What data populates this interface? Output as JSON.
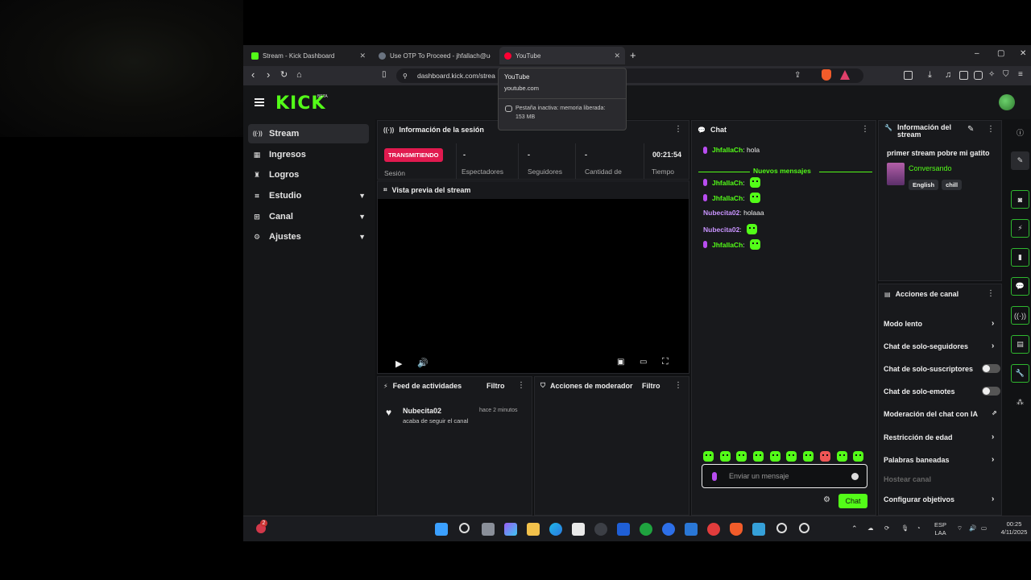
{
  "browser": {
    "tabs": [
      {
        "title": "Stream - Kick Dashboard",
        "color": "#53fc18"
      },
      {
        "title": "Use OTP To Proceed - jhfallach@ucn",
        "color": "#6a7380"
      },
      {
        "title": "YouTube",
        "color": "#ff0033"
      }
    ],
    "new_tab": "+",
    "window_controls": [
      "–",
      "▢",
      "✕"
    ],
    "url": "dashboard.kick.com/strea",
    "tooltip": {
      "title": "YouTube",
      "domain": "youtube.com",
      "memory_line1": "Pestaña inactiva: memoria liberada:",
      "memory_line2": "153 MB"
    }
  },
  "header": {
    "logo": "KICK",
    "badge": "BETA"
  },
  "sidebar": {
    "items": [
      {
        "label": "Stream",
        "icon": "stream-icon",
        "glyph": "((·))",
        "expandable": false
      },
      {
        "label": "Ingresos",
        "icon": "income-icon",
        "glyph": "▦",
        "expandable": false
      },
      {
        "label": "Logros",
        "icon": "trophy-icon",
        "glyph": "🏆",
        "expandable": false
      },
      {
        "label": "Estudio",
        "icon": "studio-icon",
        "glyph": "⌗",
        "expandable": true
      },
      {
        "label": "Canal",
        "icon": "channel-icon",
        "glyph": "⊞",
        "expandable": true
      },
      {
        "label": "Ajustes",
        "icon": "settings-icon",
        "glyph": "⚙",
        "expandable": true
      }
    ]
  },
  "session": {
    "title": "Información de la sesión",
    "live_badge": "TRANSMITIENDO",
    "session_label": "Sesión",
    "stats": [
      {
        "value": "-",
        "label": "Espectadores"
      },
      {
        "value": "-",
        "label": "Seguidores"
      },
      {
        "value": "-",
        "label": "Cantidad de"
      },
      {
        "value": "00:21:54",
        "label": "Tiempo"
      }
    ]
  },
  "preview": {
    "title": "Vista previa del stream"
  },
  "activity": {
    "title": "Feed de actividades",
    "filter": "Filtro",
    "items": [
      {
        "user": "Nubecita02",
        "time": "hace 2 minutos",
        "text": "acaba de seguir el canal"
      }
    ]
  },
  "moderator": {
    "title": "Acciones de moderador",
    "filter": "Filtro"
  },
  "chat": {
    "title": "Chat",
    "first": {
      "user": "JhfallaCh",
      "text": "hola"
    },
    "new_messages": "Nuevos mensajes",
    "messages": [
      {
        "user": "JhfallaCh",
        "text": "",
        "emote": true,
        "mic": true,
        "style": "g"
      },
      {
        "user": "JhfallaCh",
        "text": "",
        "emote": true,
        "mic": true,
        "style": "g"
      },
      {
        "user": "Nubecita02",
        "text": "holaaa",
        "emote": false,
        "mic": false,
        "style": "p"
      },
      {
        "user": "Nubecita02",
        "text": "",
        "emote": true,
        "mic": false,
        "style": "p"
      },
      {
        "user": "JhfallaCh",
        "text": "",
        "emote": true,
        "mic": true,
        "style": "g"
      }
    ],
    "placeholder": "Enviar un mensaje",
    "send": "Chat"
  },
  "stream_info": {
    "title": "Información del stream",
    "stream_title": "primer stream pobre mi gatito",
    "category": "Conversando",
    "tags": [
      "English",
      "chill"
    ]
  },
  "channel_actions": {
    "title": "Acciones de canal",
    "items": [
      {
        "label": "Modo lento",
        "control": "chevron"
      },
      {
        "label": "Chat de solo-seguidores",
        "control": "chevron"
      },
      {
        "label": "Chat de solo-suscriptores",
        "control": "toggle"
      },
      {
        "label": "Chat de solo-emotes",
        "control": "toggle"
      },
      {
        "label": "Moderación del chat con IA",
        "control": "external"
      },
      {
        "label": "Restricción de edad",
        "control": "chevron"
      },
      {
        "label": "Palabras baneadas",
        "control": "chevron"
      },
      {
        "label": "Hostear canal",
        "control": "none"
      },
      {
        "label": "Configurar objetivos",
        "control": "chevron"
      }
    ]
  },
  "taskbar": {
    "notification_count": "2",
    "lang1": "ESP",
    "lang2": "LAA",
    "time": "00:25",
    "date": "4/11/2025"
  },
  "colors": {
    "accent": "#53fc18",
    "live": "#e11a4f",
    "purple": "#c994ff"
  }
}
